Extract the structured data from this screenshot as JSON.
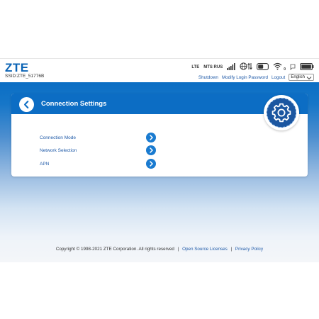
{
  "header": {
    "logo": "ZTE",
    "ssid": "SSID:ZTE_51776B",
    "status": {
      "network_type": "LTE",
      "operator": "MTS RUS"
    },
    "links": {
      "shutdown": "Shutdown",
      "modify_password": "Modify Login Password",
      "logout": "Logout"
    },
    "language": {
      "selected": "English"
    },
    "icons": [
      "signal-bars-icon",
      "globe-data-icon",
      "sim-card-icon",
      "wifi-icon",
      "sms-icon",
      "battery-icon"
    ],
    "wifi_clients": "0"
  },
  "card": {
    "title": "Connection Settings",
    "items": [
      {
        "label": "Connection Mode"
      },
      {
        "label": "Network Selection"
      },
      {
        "label": "APN"
      }
    ]
  },
  "footer": {
    "copyright": "Copyright © 1998-2021 ZTE Corporation. All rights reserved",
    "sep1": "|",
    "open_source": "Open Source Licenses",
    "sep2": "|",
    "privacy": "Privacy Policy"
  },
  "colors": {
    "brand_blue": "#0c6dc4",
    "link_blue": "#1f5aa8",
    "gear_blue": "#1b56a0"
  }
}
